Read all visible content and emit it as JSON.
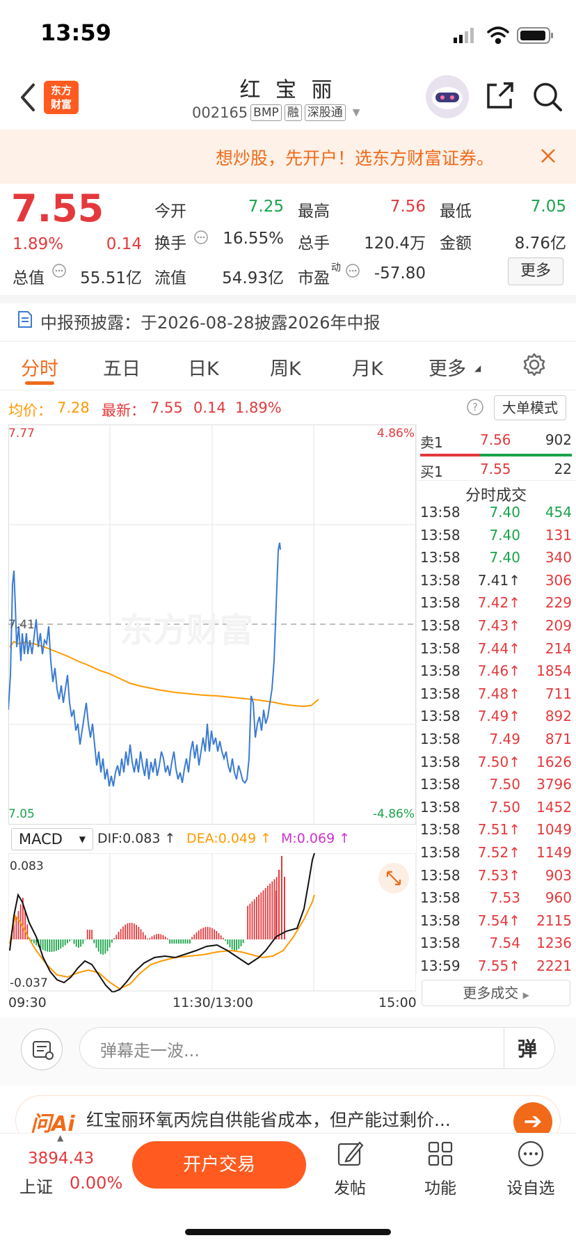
{
  "status_bar": {
    "time": "13:59"
  },
  "header": {
    "title": "红 宝 丽",
    "code": "002165",
    "tags": [
      "BMP",
      "融",
      "深股通"
    ],
    "logo_text_1": "东方",
    "logo_text_2": "财富"
  },
  "banner": {
    "text": "想炒股，先开户！选东方财富证券。"
  },
  "quote": {
    "price": "7.55",
    "change_pct": "1.89%",
    "change": "0.14",
    "fields": {
      "open_label": "今开",
      "open": "7.25",
      "high_label": "最高",
      "high": "7.56",
      "low_label": "最低",
      "low": "7.05",
      "turnover_label": "换手",
      "turnover": "16.55%",
      "volume_label": "总手",
      "volume": "120.4万",
      "amount_label": "金额",
      "amount": "8.76亿",
      "mktcap_label": "总值",
      "mktcap": "55.51亿",
      "float_label": "流值",
      "float": "54.93亿",
      "pe_label": "市盈",
      "pe_sup": "动",
      "pe": "-57.80"
    },
    "more_label": "更多"
  },
  "notice": {
    "text": "中报预披露：于2026-08-28披露2026年中报"
  },
  "tabs": [
    "分时",
    "五日",
    "日K",
    "周K",
    "月K",
    "更多"
  ],
  "info_line": {
    "avg_label": "均价：",
    "avg": "7.28",
    "latest_label": "最新：",
    "latest": "7.55",
    "change": "0.14",
    "pct": "1.89%",
    "big_order_label": "大单模式"
  },
  "intraday": {
    "top_price": "7.77",
    "bottom_price": "7.05",
    "top_pct": "4.86%",
    "bottom_pct": "-4.86%",
    "pre_close_label": "7.41",
    "watermark": "东方财富",
    "time_start": "09:30",
    "time_mid": "11:30/13:00",
    "time_end": "15:00"
  },
  "order_book": {
    "sell1_label": "卖1",
    "sell1_price": "7.56",
    "sell1_vol": "902",
    "buy1_label": "买1",
    "buy1_price": "7.55",
    "buy1_vol": "22"
  },
  "trades_title": "分时成交",
  "trades": [
    {
      "t": "13:58",
      "p": "7.40",
      "v": "454",
      "pc": "green",
      "vc": "green"
    },
    {
      "t": "13:58",
      "p": "7.40",
      "v": "131",
      "pc": "green",
      "vc": "red"
    },
    {
      "t": "13:58",
      "p": "7.40",
      "v": "340",
      "pc": "green",
      "vc": "red"
    },
    {
      "t": "13:58",
      "p": "7.41↑",
      "v": "306",
      "pc": "dark",
      "vc": "red"
    },
    {
      "t": "13:58",
      "p": "7.42↑",
      "v": "229",
      "pc": "red",
      "vc": "red"
    },
    {
      "t": "13:58",
      "p": "7.43↑",
      "v": "209",
      "pc": "red",
      "vc": "red"
    },
    {
      "t": "13:58",
      "p": "7.44↑",
      "v": "214",
      "pc": "red",
      "vc": "red"
    },
    {
      "t": "13:58",
      "p": "7.46↑",
      "v": "1854",
      "pc": "red",
      "vc": "red"
    },
    {
      "t": "13:58",
      "p": "7.48↑",
      "v": "711",
      "pc": "red",
      "vc": "red"
    },
    {
      "t": "13:58",
      "p": "7.49↑",
      "v": "892",
      "pc": "red",
      "vc": "red"
    },
    {
      "t": "13:58",
      "p": "7.49",
      "v": "871",
      "pc": "red",
      "vc": "red"
    },
    {
      "t": "13:58",
      "p": "7.50↑",
      "v": "1626",
      "pc": "red",
      "vc": "red"
    },
    {
      "t": "13:58",
      "p": "7.50",
      "v": "3796",
      "pc": "red",
      "vc": "red"
    },
    {
      "t": "13:58",
      "p": "7.50",
      "v": "1452",
      "pc": "red",
      "vc": "red"
    },
    {
      "t": "13:58",
      "p": "7.51↑",
      "v": "1049",
      "pc": "red",
      "vc": "red"
    },
    {
      "t": "13:58",
      "p": "7.52↑",
      "v": "1149",
      "pc": "red",
      "vc": "red"
    },
    {
      "t": "13:58",
      "p": "7.53↑",
      "v": "903",
      "pc": "red",
      "vc": "red"
    },
    {
      "t": "13:58",
      "p": "7.53",
      "v": "960",
      "pc": "red",
      "vc": "red"
    },
    {
      "t": "13:58",
      "p": "7.54↑",
      "v": "2115",
      "pc": "red",
      "vc": "red"
    },
    {
      "t": "13:58",
      "p": "7.54",
      "v": "1236",
      "pc": "red",
      "vc": "red"
    },
    {
      "t": "13:59",
      "p": "7.55↑",
      "v": "2221",
      "pc": "red",
      "vc": "red"
    }
  ],
  "more_trades_label": "更多成交",
  "macd": {
    "select_label": "MACD",
    "dif": "DIF:0.083 ↑",
    "dea": "DEA:0.049 ↑",
    "m": "M:0.069 ↑",
    "top": "0.083",
    "bottom": "-0.037"
  },
  "comment_bar": {
    "placeholder": "弹幕走一波...",
    "danmu_label": "弹"
  },
  "ai_bar": {
    "logo": "问Ai",
    "text": "红宝丽环氧丙烷自供能省成本，但产能过剩价..."
  },
  "bottom_nav": {
    "index_value": "3894.43",
    "index_name": "上证",
    "index_pct": "0.00%",
    "trade_label": "开户交易",
    "post_label": "发帖",
    "func_label": "功能",
    "watch_label": "设自选"
  },
  "colors": {
    "up": "#e4393c",
    "down": "#1aa34a",
    "accent": "#f06a1a",
    "avg_line": "#ff9900",
    "price_line": "#3b7bd1"
  }
}
